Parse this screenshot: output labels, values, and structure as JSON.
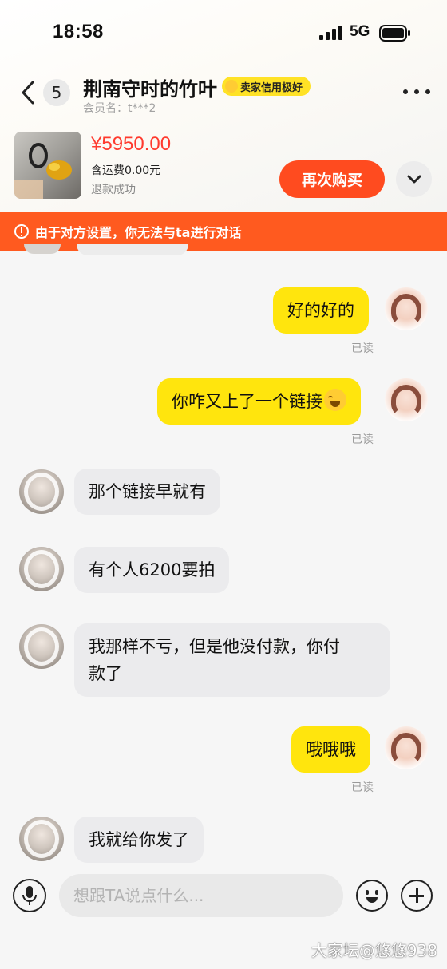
{
  "status_bar": {
    "time": "18:58",
    "network": "5G"
  },
  "header": {
    "back_count": "5",
    "contact_name": "荆南守时的竹叶",
    "seller_badge": "卖家信用极好",
    "member_label": "会员名：t***2"
  },
  "product": {
    "price": "¥5950.00",
    "shipping": "含运费0.00元",
    "status": "退款成功",
    "rebuy_label": "再次购买"
  },
  "warning": {
    "text": "由于对方设置，你无法与ta进行对话"
  },
  "messages": [
    {
      "from": "me",
      "text": "好的好的",
      "status": "已读"
    },
    {
      "from": "me",
      "text": "你咋又上了一个链接",
      "status": "已读"
    },
    {
      "from": "them",
      "text": "那个链接早就有"
    },
    {
      "from": "them",
      "text": "有个人6200要拍"
    },
    {
      "from": "them",
      "text_line1": "我那样不亏，但是他没付款，你付",
      "text_line2": "款了"
    },
    {
      "from": "me",
      "text": "哦哦哦",
      "status": "已读"
    },
    {
      "from": "them",
      "text": "我就给你发了"
    }
  ],
  "input": {
    "placeholder": "想跟TA说点什么..."
  },
  "watermark": "大家坛@悠悠938",
  "colors": {
    "accent": "#ff4b1f",
    "my_bubble": "#ffe50d",
    "their_bubble": "#ebebed",
    "price": "#ff3b2f"
  }
}
